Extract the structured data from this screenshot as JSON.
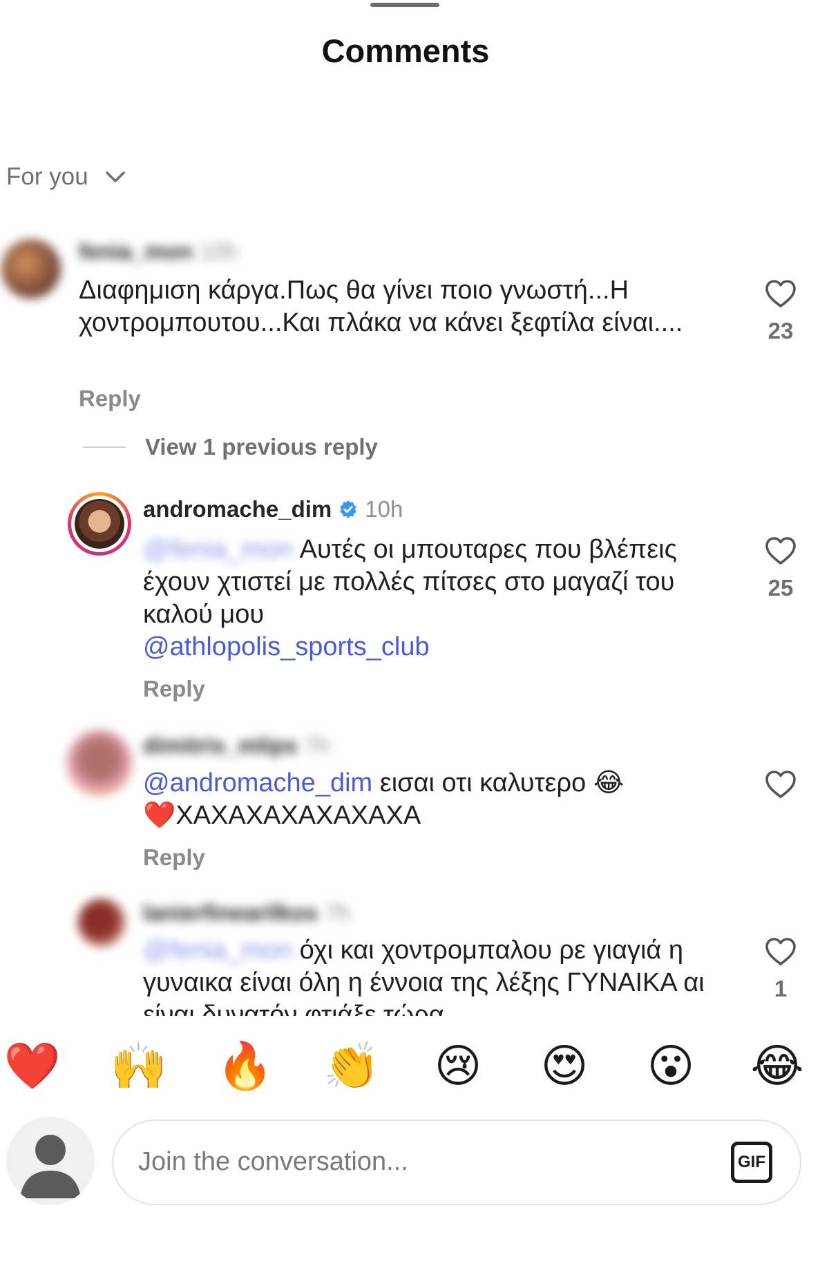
{
  "header": {
    "title": "Comments"
  },
  "filter": {
    "label": "For you"
  },
  "comments": [
    {
      "username": "fenia_mon",
      "time": "10h",
      "text": "Διαφημιση κάργα.Πως θα γίνει ποιο γνωστή...Η χοντρομπουτου...Και πλάκα να κάνει ξεφτίλα είναι....",
      "reply_label": "Reply",
      "likes": "23"
    },
    {
      "username": "andromache_dim",
      "time": "10h",
      "mention": "@fenia_mon",
      "text": "Αυτές οι μπουταρες που βλέπεις έχουν χτιστεί με πολλές πίτσες στο μαγαζί του καλού μου",
      "mention2": "@athlopolis_sports_club",
      "reply_label": "Reply",
      "likes": "25"
    },
    {
      "username": "dimitris_mlips",
      "time": "7h",
      "mention": "@andromache_dim",
      "text": "εισαι οτι καλυτερο",
      "emoji1": "😂",
      "emoji2": "❤️",
      "text2": "ΧΑΧΑΧΑΧΑΧΑΧΑΧΑ",
      "reply_label": "Reply"
    },
    {
      "username": "lanierfinearilkos",
      "time": "7h",
      "mention": "@fenia_mon",
      "text": "όχι και χοντρομπαλου ρε γιαγιά η γυναικα είναι όλη η έννοια της λέξης ΓΥΝΑΙΚΑ αι είναι δυνατόν φτιάξε τώρα",
      "likes": "1"
    }
  ],
  "view_previous": "View 1 previous reply",
  "reactions": [
    "❤️",
    "🙌",
    "🔥",
    "👏",
    "😢",
    "😍",
    "😮",
    "😂"
  ],
  "composer": {
    "placeholder": "Join the conversation...",
    "gif_label": "GIF"
  },
  "colors": {
    "mention": "#4a5bd6",
    "verified": "#3897f0",
    "muted": "#8a8a8a"
  }
}
